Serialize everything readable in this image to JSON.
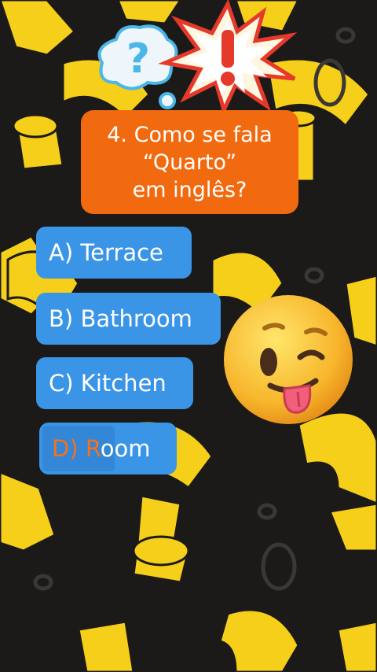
{
  "question": {
    "lines": [
      "4. Como se fala",
      "“Quarto”",
      "em inglês?"
    ]
  },
  "answers": [
    {
      "letter": "A)",
      "text": "Terrace"
    },
    {
      "letter": "B)",
      "text": "Bathroom"
    },
    {
      "letter": "C)",
      "text": "Kitchen"
    },
    {
      "letter": "D)",
      "text": "Room",
      "selected_prefix": "D) R",
      "rest": "oom"
    }
  ],
  "icons": {
    "thought_bubble": "question-bubble-icon",
    "burst": "exclamation-burst-icon",
    "emoji": "winking-tongue-emoji-icon"
  },
  "colors": {
    "background": "#1c1a18",
    "question_box": "#f26a10",
    "answer_box": "#3a95e6",
    "highlight_text": "#f5711d",
    "pattern": "#f5cf1a"
  }
}
